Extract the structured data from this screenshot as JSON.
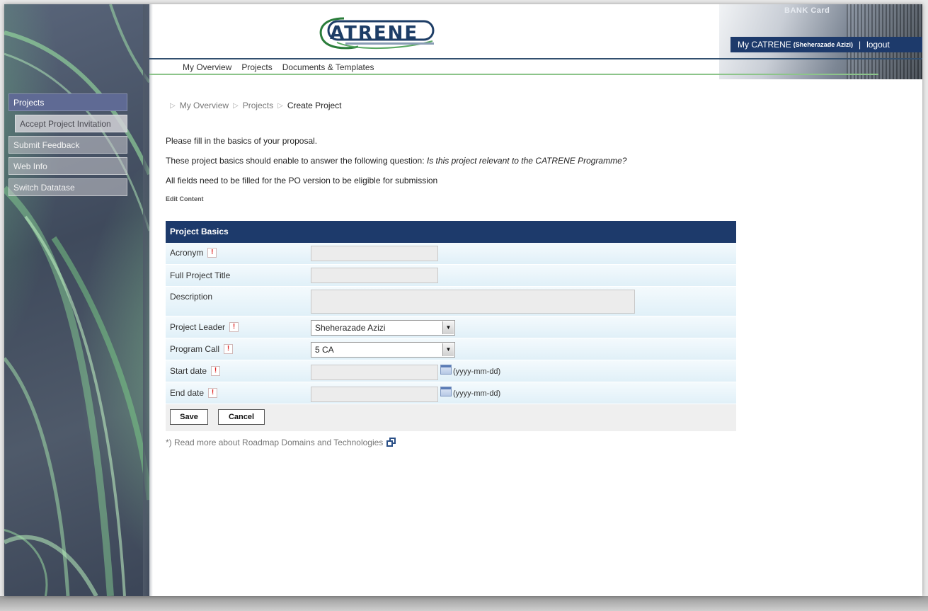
{
  "header": {
    "logo_text": "ATRENE",
    "bank_card_label": "BANK Card",
    "user_prefix": "My CATRENE",
    "user_name": "(Sheherazade Azizi)",
    "separator": "|",
    "logout_label": "logout"
  },
  "topnav": {
    "items": [
      "My Overview",
      "Projects",
      "Documents & Templates"
    ]
  },
  "sidebar": {
    "items": [
      {
        "label": "Projects"
      },
      {
        "label": "Accept Project Invitation"
      },
      {
        "label": "Submit Feedback"
      },
      {
        "label": "Web Info"
      },
      {
        "label": "Switch Datatase"
      }
    ]
  },
  "breadcrumb": {
    "items": [
      "My Overview",
      "Projects",
      "Create Project"
    ]
  },
  "intro": {
    "line1": "Please fill in the basics of your proposal.",
    "line2_prefix": "These project basics should enable to answer the following question: ",
    "line2_question": "Is this project relevant to the CATRENE Programme?",
    "line3": "All fields need to be filled for the PO version to be eligible for submission",
    "edit_content": "Edit Content"
  },
  "form": {
    "title": "Project Basics",
    "required_mark": "!",
    "acronym_label": "Acronym",
    "acronym_value": "",
    "title_label": "Full Project Title",
    "title_value": "",
    "description_label": "Description",
    "description_value": "",
    "leader_label": "Project Leader",
    "leader_value": "Sheherazade Azizi",
    "call_label": "Program Call",
    "call_value": "5 CA",
    "start_label": "Start date",
    "start_value": "",
    "end_label": "End date",
    "end_value": "",
    "date_format": "(yyyy-mm-dd)",
    "save_label": "Save",
    "cancel_label": "Cancel"
  },
  "footer_note": {
    "text": "*) Read more about Roadmap Domains and Technologies"
  },
  "colors": {
    "brand_navy": "#1d3a6b",
    "nav_green": "#8cc48a",
    "sidebar_active": "#5f6a94",
    "required_red": "#dd2222"
  }
}
